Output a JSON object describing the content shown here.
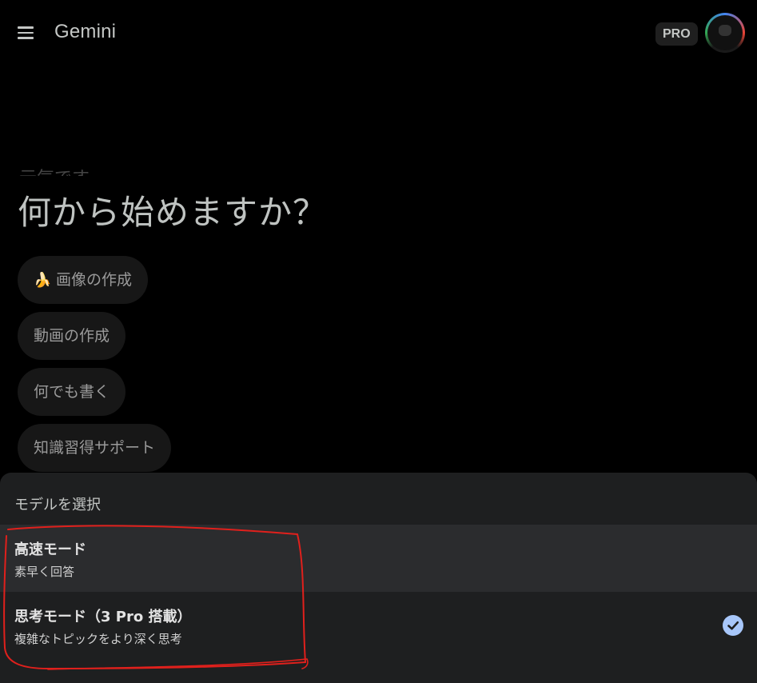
{
  "header": {
    "title": "Gemini",
    "badge": "PRO",
    "menu_icon": "hamburger-menu-icon",
    "avatar_icon": "account-avatar"
  },
  "greeting": {
    "partial": "元気です",
    "title": "何から始めますか？"
  },
  "suggestions": [
    {
      "label": "画像の作成",
      "icon": "banana-icon"
    },
    {
      "label": "動画の作成"
    },
    {
      "label": "何でも書く"
    },
    {
      "label": "知識習得サポート"
    }
  ],
  "model_sheet": {
    "title": "モデルを選択",
    "options": [
      {
        "title": "高速モード",
        "subtitle": "素早く回答",
        "selected": false
      },
      {
        "title": "思考モード（3 Pro 搭載）",
        "subtitle": "複雑なトピックをより深く思考",
        "selected": true
      }
    ],
    "check_icon": "check-circle-icon"
  },
  "colors": {
    "background": "#000000",
    "sheet": "#1e1f20",
    "highlight_row": "#2b2c2e",
    "check": "#a8c7fa",
    "annotation": "#e0201c"
  }
}
